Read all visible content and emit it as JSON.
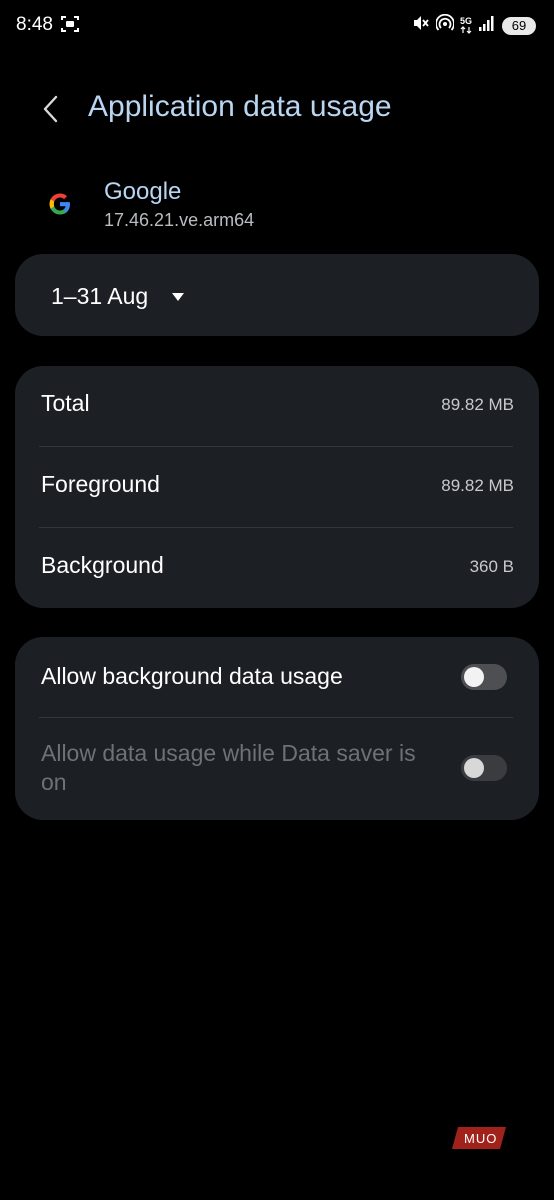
{
  "status_bar": {
    "time": "8:48",
    "battery": "69",
    "network": "5G",
    "icons": [
      "screen-record-icon",
      "mute-icon",
      "hotspot-icon",
      "signal-icon",
      "battery-icon"
    ]
  },
  "header": {
    "title": "Application data usage",
    "back_icon": "back-chevron-icon"
  },
  "app": {
    "name": "Google",
    "version": "17.46.21.ve.arm64",
    "icon": "google-icon"
  },
  "period": {
    "label": "1–31 Aug",
    "icon": "dropdown-triangle-icon"
  },
  "usage": {
    "rows": [
      {
        "label": "Total",
        "value": "89.82 MB"
      },
      {
        "label": "Foreground",
        "value": "89.82 MB"
      },
      {
        "label": "Background",
        "value": "360 B"
      }
    ]
  },
  "settings": {
    "toggles": [
      {
        "label": "Allow background data usage",
        "enabled": true,
        "checked": false
      },
      {
        "label": "Allow data usage while Data saver is on",
        "enabled": false,
        "checked": false
      }
    ]
  },
  "watermark": {
    "text": "MUO"
  },
  "colors": {
    "background": "#000000",
    "card": "#1c1f24",
    "accent_title": "#b8d6f2",
    "disabled_text": "#6e7176",
    "watermark": "#b3261e"
  }
}
